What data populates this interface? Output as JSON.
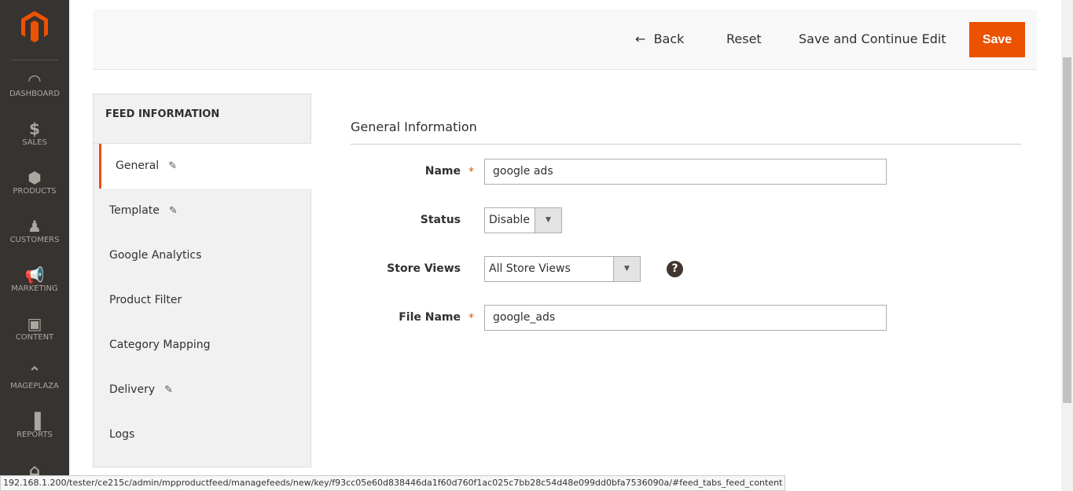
{
  "sidebar": {
    "items": [
      {
        "label": "DASHBOARD",
        "icon": "dashboard-icon",
        "glyph": "◠"
      },
      {
        "label": "SALES",
        "icon": "dollar-icon",
        "glyph": "$"
      },
      {
        "label": "PRODUCTS",
        "icon": "box-icon",
        "glyph": "⬢"
      },
      {
        "label": "CUSTOMERS",
        "icon": "person-icon",
        "glyph": "♟"
      },
      {
        "label": "MARKETING",
        "icon": "megaphone-icon",
        "glyph": "📢"
      },
      {
        "label": "CONTENT",
        "icon": "layout-icon",
        "glyph": "▣"
      },
      {
        "label": "MAGEPLAZA",
        "icon": "chevron-up-icon",
        "glyph": "⌃"
      },
      {
        "label": "REPORTS",
        "icon": "bar-chart-icon",
        "glyph": "▐"
      },
      {
        "label": "",
        "icon": "store-icon",
        "glyph": "⌂"
      }
    ]
  },
  "toolbar": {
    "back": "Back",
    "reset": "Reset",
    "save_continue": "Save and Continue Edit",
    "save": "Save"
  },
  "tabs": {
    "title": "FEED INFORMATION",
    "items": [
      {
        "label": "General",
        "edited": true
      },
      {
        "label": "Template",
        "edited": true
      },
      {
        "label": "Google Analytics"
      },
      {
        "label": "Product Filter"
      },
      {
        "label": "Category Mapping"
      },
      {
        "label": "Delivery",
        "edited": true
      },
      {
        "label": "Logs"
      }
    ]
  },
  "form": {
    "section": "General Information",
    "name_label": "Name",
    "name_value": "google ads",
    "status_label": "Status",
    "status_value": "Disable",
    "store_label": "Store Views",
    "store_value": "All Store Views",
    "file_label": "File Name",
    "file_value": "google_ads"
  },
  "status_bar": "192.168.1.200/tester/ce215c/admin/mpproductfeed/managefeeds/new/key/f93cc05e60d838446da1f60d760f1ac025c7bb28c54d48e099dd0bfa7536090a/#feed_tabs_feed_content",
  "colors": {
    "accent": "#eb5202",
    "sidebar": "#373330"
  }
}
